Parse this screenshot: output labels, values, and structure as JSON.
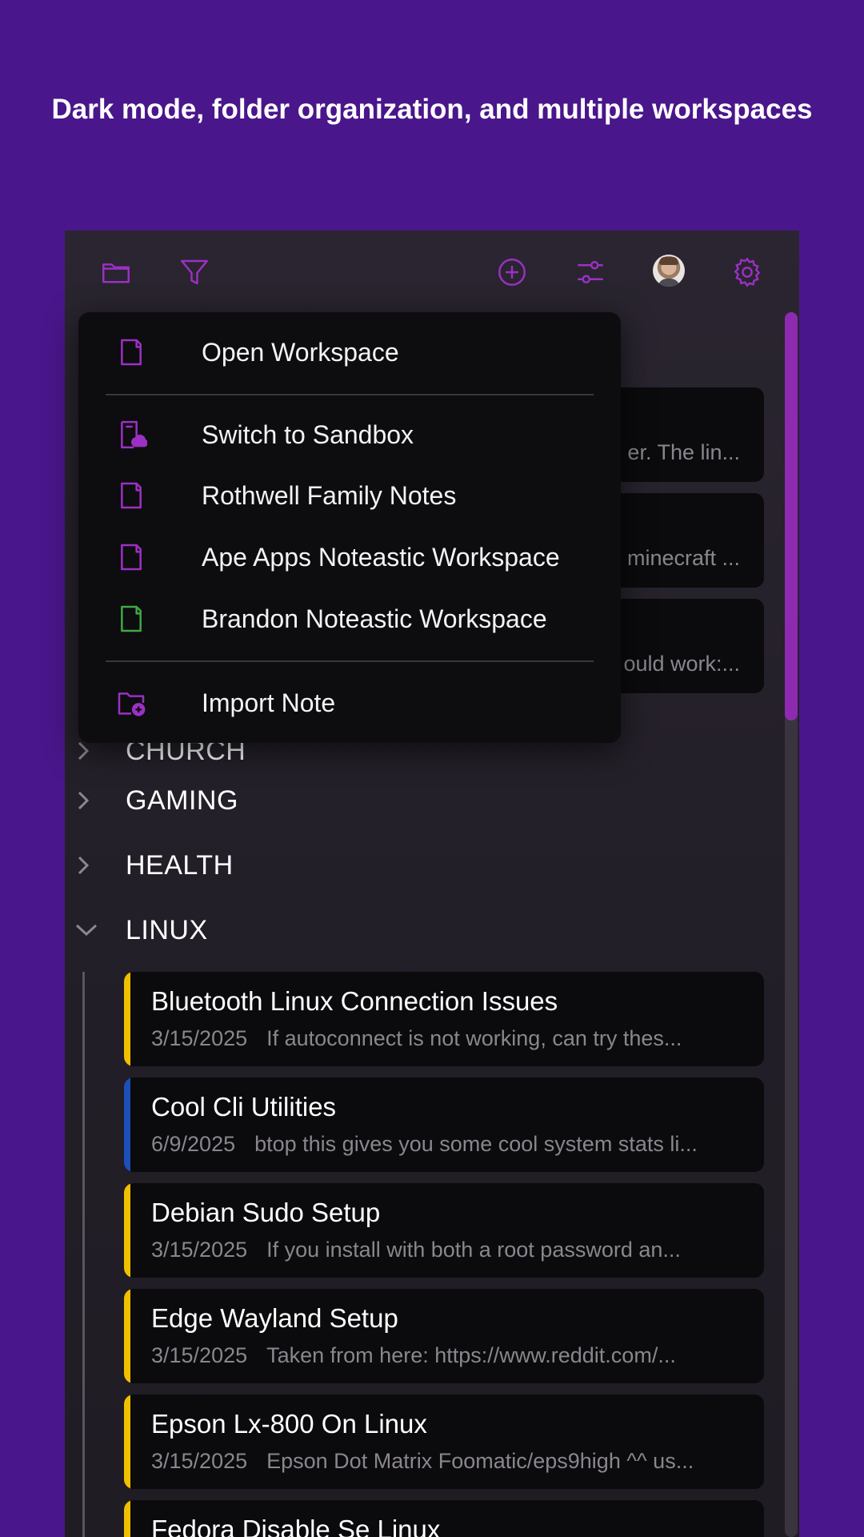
{
  "banner": {
    "text": "Dark mode, folder organization, and multiple workspaces"
  },
  "colors": {
    "accent": "#9b30c4",
    "background": "#4a168b",
    "yellow": "#f0c000",
    "blue": "#1d4fb8",
    "green": "#3fa844"
  },
  "toolbar": {
    "icons": [
      "folder-icon",
      "filter-icon",
      "add-circle-icon",
      "sliders-icon",
      "avatar",
      "gear-icon"
    ]
  },
  "workspace_menu": {
    "open_label": "Open Workspace",
    "items": [
      {
        "label": "Switch to Sandbox",
        "icon": "cloud-device-icon",
        "color": "#9b30c4"
      },
      {
        "label": "Rothwell Family Notes",
        "icon": "notebook-icon",
        "color": "#9b30c4"
      },
      {
        "label": "Ape Apps Noteastic Workspace",
        "icon": "notebook-icon",
        "color": "#9b30c4"
      },
      {
        "label": "Brandon Noteastic Workspace",
        "icon": "notebook-icon",
        "color": "#3fa844"
      }
    ],
    "import_label": "Import Note"
  },
  "background_peeks": [
    "er. The lin...",
    "minecraft ...",
    "ould work:..."
  ],
  "folders": [
    {
      "label": "CHURCH",
      "expanded": false
    },
    {
      "label": "GAMING",
      "expanded": false
    },
    {
      "label": "HEALTH",
      "expanded": false
    },
    {
      "label": "LINUX",
      "expanded": true
    }
  ],
  "notes": [
    {
      "title": "Bluetooth Linux Connection Issues",
      "date": "3/15/2025",
      "preview": "If autoconnect is not working, can try thes...",
      "color": "#f0c000"
    },
    {
      "title": "Cool Cli Utilities",
      "date": "6/9/2025",
      "preview": "btop this gives you some cool system stats li...",
      "color": "#1d4fb8"
    },
    {
      "title": "Debian Sudo Setup",
      "date": "3/15/2025",
      "preview": "If you install with both a root password an...",
      "color": "#f0c000"
    },
    {
      "title": "Edge Wayland Setup",
      "date": "3/15/2025",
      "preview": "Taken from here: https://www.reddit.com/...",
      "color": "#f0c000"
    },
    {
      "title": "Epson Lx-800 On Linux",
      "date": "3/15/2025",
      "preview": "Epson Dot Matrix Foomatic/eps9high ^^ us...",
      "color": "#f0c000"
    },
    {
      "title": "Fedora Disable Se Linux",
      "date": "",
      "preview": "",
      "color": "#f0c000"
    }
  ]
}
